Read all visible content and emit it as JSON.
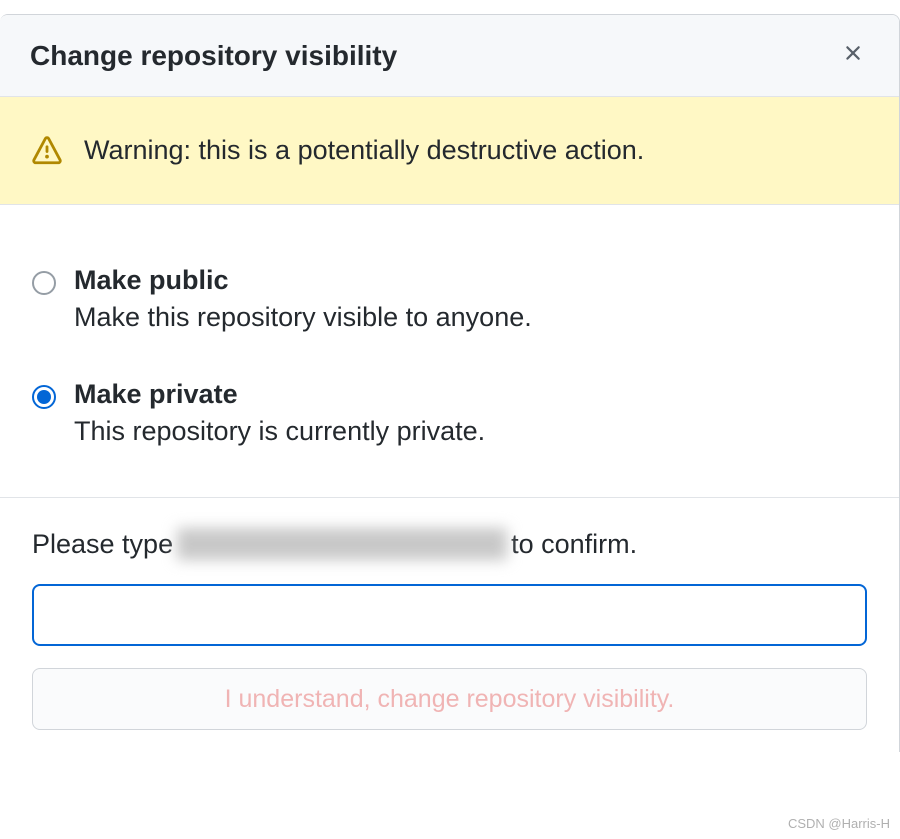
{
  "modal": {
    "title": "Change repository visibility",
    "warning": "Warning: this is a potentially destructive action.",
    "options": [
      {
        "label": "Make public",
        "desc": "Make this repository visible to anyone.",
        "selected": false
      },
      {
        "label": "Make private",
        "desc": "This repository is currently private.",
        "selected": true
      }
    ],
    "confirm": {
      "prefix": "Please type ",
      "suffix": "to confirm.",
      "button": "I understand, change repository visibility."
    }
  },
  "watermark": "CSDN @Harris-H"
}
